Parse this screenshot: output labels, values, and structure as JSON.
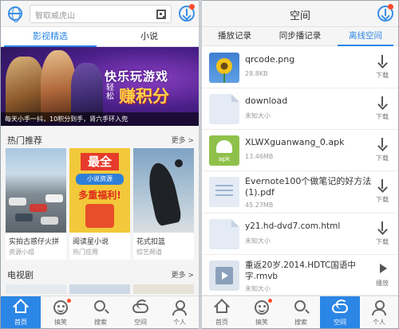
{
  "left": {
    "search": {
      "placeholder": "智取威虎山"
    },
    "tabs": [
      {
        "label": "影视精选",
        "active": true
      },
      {
        "label": "小说",
        "active": false
      }
    ],
    "banner": {
      "title_line1": "快乐玩游戏",
      "title_line2": "轻松",
      "title_line3": "赚积分",
      "caption": "每天小手一抖，10积分到手，肾六手环入兜",
      "slide_count": 5,
      "active_slide": 3
    },
    "hot": {
      "title": "热门推荐",
      "more": "更多 >",
      "cards": [
        {
          "title": "实拍古惑仔火拼",
          "sub": "资源小组"
        },
        {
          "title": "阅读星小说",
          "sub": "热门应用",
          "banner_big": "最全",
          "banner_mid": "小说资源",
          "banner_big2": "多重福利!"
        },
        {
          "title": "花式扣篮",
          "sub": "综艺频道"
        }
      ]
    },
    "tv": {
      "title": "电视剧",
      "more": "更多 >"
    },
    "nav": [
      {
        "label": "首页",
        "icon": "home-icon",
        "active": true
      },
      {
        "label": "搞笑",
        "icon": "smile-icon",
        "active": false
      },
      {
        "label": "搜索",
        "icon": "search-icon",
        "active": false
      },
      {
        "label": "空间",
        "icon": "cloud-icon",
        "active": false
      },
      {
        "label": "个人",
        "icon": "person-icon",
        "active": false
      }
    ]
  },
  "right": {
    "title": "空间",
    "tabs": [
      {
        "label": "播放记录",
        "active": false
      },
      {
        "label": "同步播记录",
        "active": false
      },
      {
        "label": "离线空间",
        "active": true
      }
    ],
    "files": [
      {
        "name": "qrcode.png",
        "size": "28.8KB",
        "icon": "image-file-icon",
        "action": "下载"
      },
      {
        "name": "download",
        "size": "未知大小",
        "icon": "document-icon",
        "action": "下载"
      },
      {
        "name": "XLWXguanwang_0.apk",
        "size": "13.46MB",
        "icon": "apk-icon",
        "action": "下载",
        "icon_label": "apk"
      },
      {
        "name": "Evernote100个做笔记的好方法(1).pdf",
        "size": "45.27MB",
        "icon": "pdf-icon",
        "action": "下载"
      },
      {
        "name": "y21.hd-dvd7.com.html",
        "size": "未知大小",
        "icon": "document-icon",
        "action": "下载"
      },
      {
        "name": "重返20岁.2014.HDTC国语中字.rmvb",
        "size": "未知大小",
        "icon": "video-file-icon",
        "action": "播放"
      }
    ],
    "nav": [
      {
        "label": "首页",
        "icon": "home-icon",
        "active": false
      },
      {
        "label": "搞笑",
        "icon": "smile-icon",
        "active": false
      },
      {
        "label": "搜索",
        "icon": "search-icon",
        "active": false
      },
      {
        "label": "空间",
        "icon": "cloud-icon",
        "active": true
      },
      {
        "label": "个人",
        "icon": "person-icon",
        "active": false
      }
    ]
  },
  "colors": {
    "accent": "#2b86e6",
    "badge": "#ff4a2a"
  }
}
